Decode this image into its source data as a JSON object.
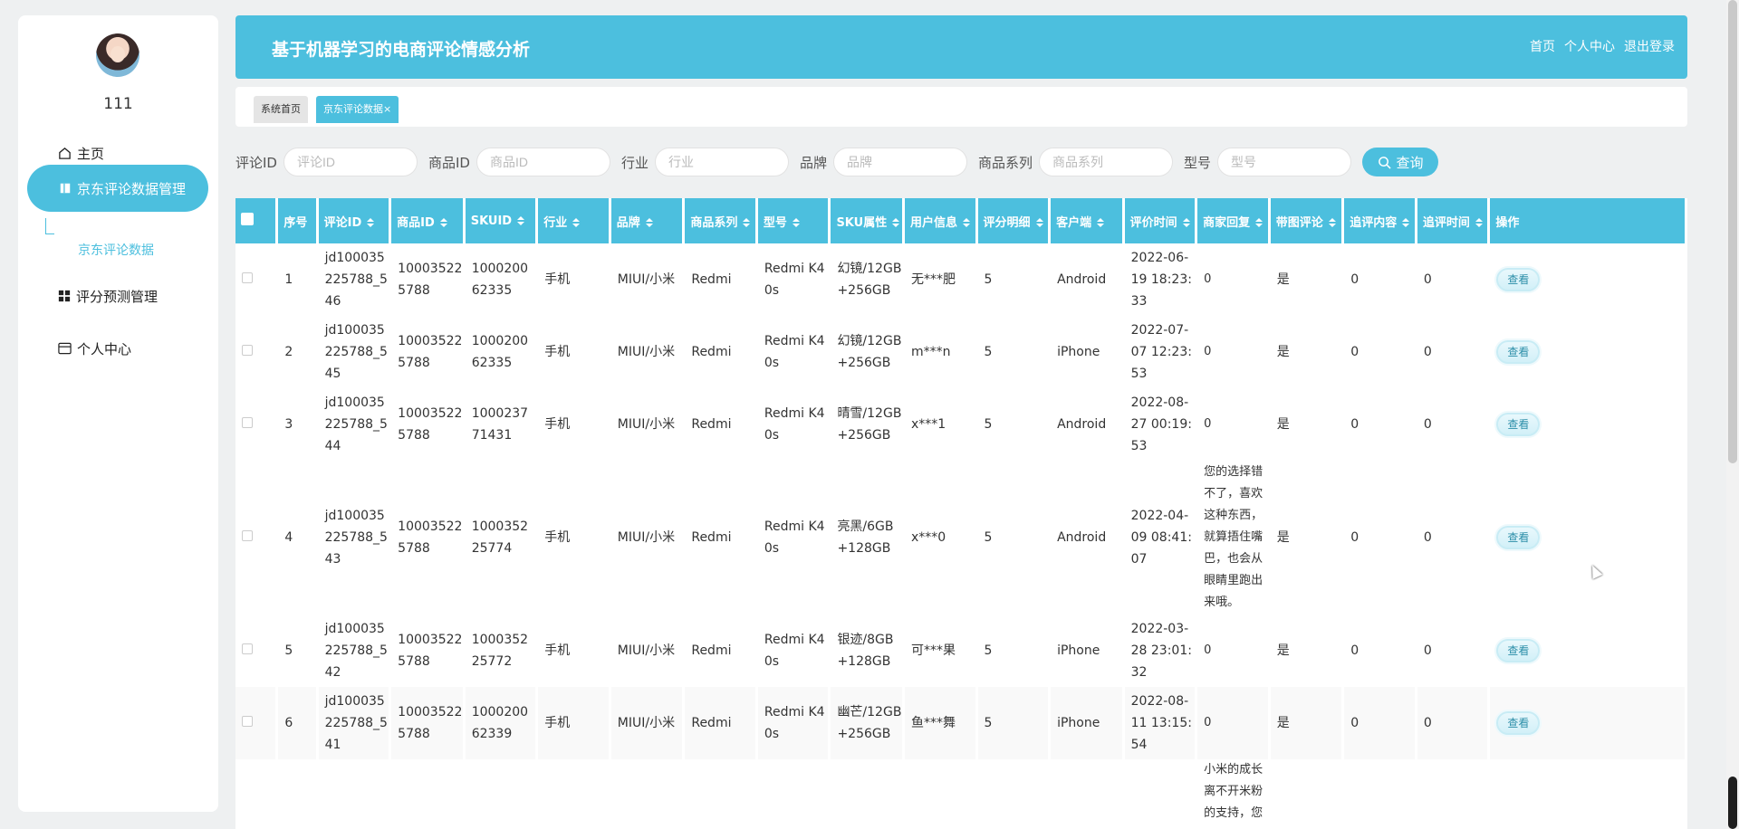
{
  "sidebar": {
    "username": "111",
    "items": [
      {
        "label": "主页",
        "icon": "home-icon"
      },
      {
        "label": "京东评论数据管理",
        "icon": "book-icon",
        "active": true
      },
      {
        "label": "评分预测管理",
        "icon": "grid-icon"
      },
      {
        "label": "个人中心",
        "icon": "card-icon"
      }
    ],
    "sub_item": "京东评论数据"
  },
  "header": {
    "title": "基于机器学习的电商评论情感分析",
    "links": [
      "首页",
      "个人中心",
      "退出登录"
    ]
  },
  "tabs": {
    "home": "系统首页",
    "active": "京东评论数据",
    "close": "×"
  },
  "search": {
    "fields": [
      {
        "label": "评论ID",
        "placeholder": "评论ID"
      },
      {
        "label": "商品ID",
        "placeholder": "商品ID"
      },
      {
        "label": "行业",
        "placeholder": "行业"
      },
      {
        "label": "品牌",
        "placeholder": "品牌"
      },
      {
        "label": "商品系列",
        "placeholder": "商品系列"
      },
      {
        "label": "型号",
        "placeholder": "型号"
      }
    ],
    "button": "查询"
  },
  "table": {
    "headers": [
      "序号",
      "评论ID",
      "商品ID",
      "SKUID",
      "行业",
      "品牌",
      "商品系列",
      "型号",
      "SKU属性",
      "用户信息",
      "评分明细",
      "客户端",
      "评价时间",
      "商家回复",
      "带图评论",
      "追评内容",
      "追评时间",
      "操作"
    ],
    "action_label": "查看",
    "rows": [
      [
        "1",
        "jd100035225788_546",
        "100035225788",
        "100020062335",
        "手机",
        "MIUI/小米",
        "Redmi",
        "Redmi K40s",
        "幻镜/12GB+256GB",
        "无***肥",
        "5",
        "Android",
        "2022-06-19 18:23:33",
        "0",
        "是",
        "0",
        "0"
      ],
      [
        "2",
        "jd100035225788_545",
        "100035225788",
        "100020062335",
        "手机",
        "MIUI/小米",
        "Redmi",
        "Redmi K40s",
        "幻镜/12GB+256GB",
        "m***n",
        "5",
        "iPhone",
        "2022-07-07 12:23:53",
        "0",
        "是",
        "0",
        "0"
      ],
      [
        "3",
        "jd100035225788_544",
        "100035225788",
        "100023771431",
        "手机",
        "MIUI/小米",
        "Redmi",
        "Redmi K40s",
        "晴雪/12GB+256GB",
        "x***1",
        "5",
        "Android",
        "2022-08-27 00:19:53",
        "0",
        "是",
        "0",
        "0"
      ],
      [
        "4",
        "jd100035225788_543",
        "100035225788",
        "100035225774",
        "手机",
        "MIUI/小米",
        "Redmi",
        "Redmi K40s",
        "亮黑/6GB+128GB",
        "x***0",
        "5",
        "Android",
        "2022-04-09 08:41:07",
        "您的选择错不了，喜欢这种东西，就算捂住嘴巴，也会从眼睛里跑出来哦。",
        "是",
        "0",
        "0"
      ],
      [
        "5",
        "jd100035225788_542",
        "100035225788",
        "100035225772",
        "手机",
        "MIUI/小米",
        "Redmi",
        "Redmi K40s",
        "银迹/8GB+128GB",
        "可***果",
        "5",
        "iPhone",
        "2022-03-28 23:01:32",
        "0",
        "是",
        "0",
        "0"
      ],
      [
        "6",
        "jd100035225788_541",
        "100035225788",
        "100020062339",
        "手机",
        "MIUI/小米",
        "Redmi",
        "Redmi K40s",
        "幽芒/12GB+256GB",
        "鱼***舞",
        "5",
        "iPhone",
        "2022-08-11 13:15:54",
        "0",
        "是",
        "0",
        "0"
      ],
      [
        "",
        "",
        "",
        "",
        "",
        "",
        "",
        "",
        "",
        "",
        "",
        "",
        "",
        "小米的成长离不开米粉的支持，您",
        "",
        "",
        ""
      ]
    ]
  }
}
